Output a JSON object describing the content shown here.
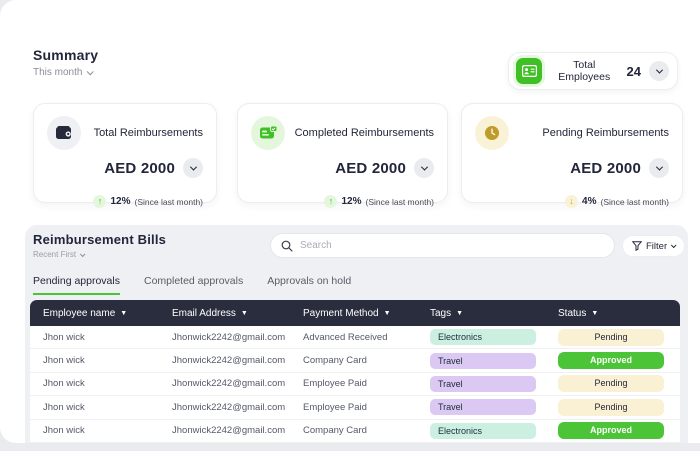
{
  "summary": {
    "title": "Summary",
    "period": "This month"
  },
  "employees_widget": {
    "label": "Total Employees",
    "count": "24"
  },
  "cards": [
    {
      "title": "Total Reimbursements",
      "amount": "AED 2000",
      "change": "12%",
      "change_note": "(Since last month)",
      "direction": "up",
      "accent": "#2a2d3d"
    },
    {
      "title": "Completed Reimbursements",
      "amount": "AED 2000",
      "change": "12%",
      "change_note": "(Since last month)",
      "direction": "up",
      "accent": "#4cc437"
    },
    {
      "title": "Pending Reimbursements",
      "amount": "AED 2000",
      "change": "4%",
      "change_note": "(Since last month)",
      "direction": "down",
      "accent": "#c9a22d"
    }
  ],
  "bills": {
    "title": "Reimbursement Bills",
    "sort_label": "Recent First",
    "search_placeholder": "Search",
    "filter_label": "Filter",
    "tabs": [
      {
        "label": "Pending approvals",
        "active": true
      },
      {
        "label": "Completed approvals",
        "active": false
      },
      {
        "label": "Approvals on hold",
        "active": false
      }
    ],
    "table": {
      "columns": [
        "Employee name",
        "Email Address",
        "Payment Method",
        "Tags",
        "Status"
      ],
      "rows": [
        {
          "name": "Jhon wick",
          "email": "Jhonwick2242@gmail.com",
          "payment": "Advanced Received",
          "tag": "Electronics",
          "status": "Pending"
        },
        {
          "name": "Jhon wick",
          "email": "Jhonwick2242@gmail.com",
          "payment": "Company Card",
          "tag": "Travel",
          "status": "Approved"
        },
        {
          "name": "Jhon wick",
          "email": "Jhonwick2242@gmail.com",
          "payment": "Employee Paid",
          "tag": "Travel",
          "status": "Pending"
        },
        {
          "name": "Jhon wick",
          "email": "Jhonwick2242@gmail.com",
          "payment": "Employee Paid",
          "tag": "Travel",
          "status": "Pending"
        },
        {
          "name": "Jhon wick",
          "email": "Jhonwick2242@gmail.com",
          "payment": "Company Card",
          "tag": "Electronics",
          "status": "Approved"
        }
      ]
    }
  },
  "colors": {
    "accent_green": "#4cc437",
    "accent_gold": "#c9a22d",
    "header_navy": "#2a2d3d",
    "tag_electronics_bg": "#cbf0e2",
    "tag_travel_bg": "#dbc9f3",
    "status_pending_bg": "#faf0d4",
    "status_approved_bg": "#4cc437"
  }
}
